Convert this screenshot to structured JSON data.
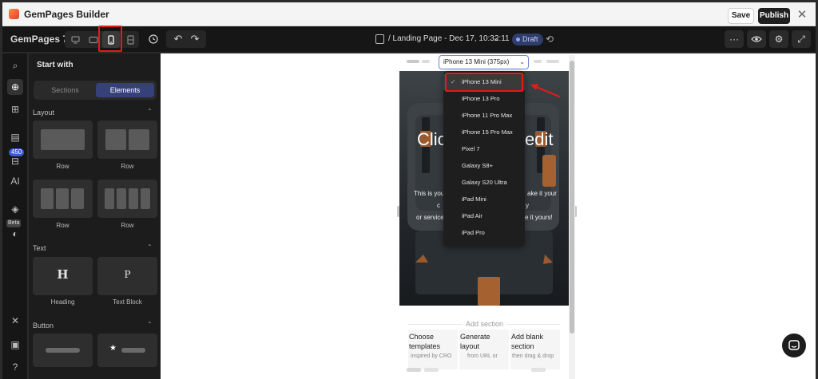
{
  "app": {
    "title": "GemPages Builder"
  },
  "titlebar": {
    "save_label": "Save",
    "publish_label": "Publish",
    "close_glyph": "✕"
  },
  "toolbar": {
    "brand": "GemPages 7",
    "page_title": "/ Landing Page - Dec 17, 10:32:11",
    "status_badge": "Draft",
    "more_glyph": "···"
  },
  "rail": {
    "badge_count": "450",
    "ai_label": "AI",
    "beta_label": "Beta"
  },
  "panel": {
    "title": "Start with",
    "tabs": [
      {
        "label": "Sections"
      },
      {
        "label": "Elements"
      }
    ],
    "groups": [
      {
        "title": "Layout",
        "items": [
          {
            "label": "Row"
          },
          {
            "label": "Row"
          },
          {
            "label": "Row"
          },
          {
            "label": "Row"
          }
        ]
      },
      {
        "title": "Text",
        "items": [
          {
            "label": "Heading",
            "glyph": "H"
          },
          {
            "label": "Text Block",
            "glyph": "P"
          }
        ]
      },
      {
        "title": "Button",
        "items": [
          {
            "label": ""
          },
          {
            "label": ""
          }
        ]
      }
    ]
  },
  "preview": {
    "device_select": "iPhone 13 Mini (375px)",
    "devices": [
      {
        "label": "iPhone 13 Mini",
        "selected": true
      },
      {
        "label": "iPhone 13 Pro"
      },
      {
        "label": "iPhone 11 Pro Max"
      },
      {
        "label": "iPhone 15 Pro Max"
      },
      {
        "label": "Pixel 7"
      },
      {
        "label": "Galaxy S8+"
      },
      {
        "label": "Galaxy S20 Ultra"
      },
      {
        "label": "iPad Mini"
      },
      {
        "label": "iPad Air"
      },
      {
        "label": "iPad Pro"
      }
    ],
    "hero": {
      "title_left": "Clic",
      "title_right": "edit",
      "line1_left": "This is you",
      "line1_right": "ake it your",
      "line2_left": "c",
      "line2_right": "y",
      "line3_left": "or service",
      "line3_right": "e it yours!"
    },
    "add_section": "Add section",
    "options": [
      {
        "title": "Choose\ntemplates",
        "sub": "inspired by CRO"
      },
      {
        "title": "Generate\nlayout",
        "sub": "from URL or"
      },
      {
        "title": "Add blank\nsection",
        "sub": "then drag & drop"
      }
    ]
  },
  "colors": {
    "accent_red": "#e01c1c",
    "segment_active": "#36417a",
    "draft_badge": "#2f3d6b"
  }
}
